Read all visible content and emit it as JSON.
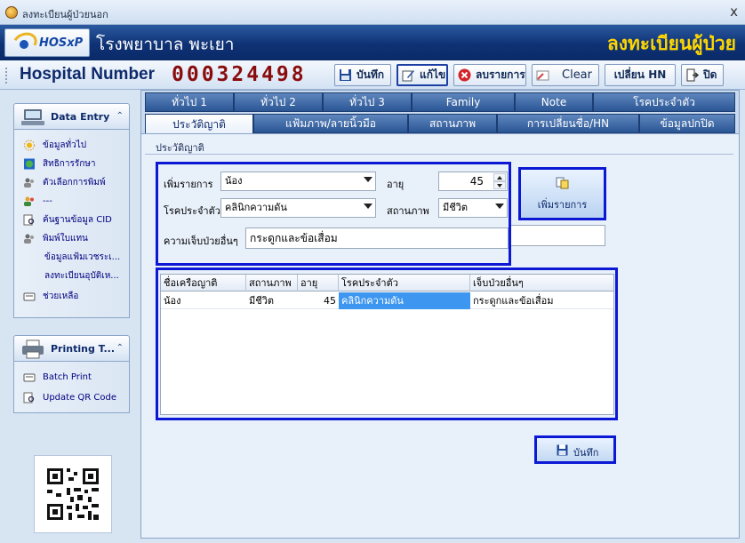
{
  "window": {
    "title": "ลงทะเบียนผู้ป่วยนอก",
    "close_label": "x"
  },
  "banner": {
    "logo_text": "HOSxP",
    "hospital_name": "โรงพยาบาล พะเยา",
    "module_name": "ลงทะเบียนผู้ป่วย"
  },
  "hn": {
    "label": "Hospital Number",
    "value": "000324498"
  },
  "toolbar": {
    "save": "บันทึก",
    "edit": "แก้ไข",
    "delete": "ลบรายการ",
    "clear": "Clear",
    "change_hn": "เปลี่ยน HN",
    "close": "ปิด"
  },
  "sidebar": {
    "data_entry": {
      "title": "Data Entry",
      "items": [
        {
          "label": "ข้อมูลทั่วไป",
          "icon": "sun-icon"
        },
        {
          "label": "สิทธิการรักษา",
          "icon": "globe-icon"
        },
        {
          "label": "ตัวเลือกการพิมพ์",
          "icon": "people-icon"
        },
        {
          "label": "---",
          "icon": "users-icon"
        },
        {
          "label": "ค้นฐานข้อมูล CID",
          "icon": "search-doc-icon"
        },
        {
          "label": "พิมพ์ใบแทน",
          "icon": "people-icon"
        },
        {
          "label": "ข้อมูลแฟ้มเวชระเ...",
          "icon": ""
        },
        {
          "label": "ลงทะเบียนอุบัติเห...",
          "icon": ""
        },
        {
          "label": "ช่วยเหลือ",
          "icon": "card-icon"
        }
      ]
    },
    "printing": {
      "title": "Printing T...",
      "items": [
        {
          "label": "Batch Print",
          "icon": "card-icon"
        },
        {
          "label": "Update QR Code",
          "icon": "search-doc-icon"
        }
      ]
    }
  },
  "tabs": {
    "row1": [
      "ทั่วไป 1",
      "ทั่วไป 2",
      "ทั่วไป 3",
      "Family",
      "Note",
      "โรคประจำตัว"
    ],
    "row2": [
      "ประวัติญาติ",
      "แฟ้มภาพ/ลายนิ้วมือ",
      "สถานภาพ",
      "การเปลี่ยนชื่อ/HN",
      "ข้อมูลปกปิด"
    ],
    "active": "ประวัติญาติ"
  },
  "relatives": {
    "section_title": "ประวัติญาติ",
    "form": {
      "add_item_label": "เพิ่มรายการ",
      "add_item_value": "น้อง",
      "age_label": "อายุ",
      "age_value": "45",
      "disease_label": "โรคประจำตัว",
      "disease_value": "คลินิกความดัน",
      "status_label": "สถานภาพ",
      "status_value": "มีชีวิต",
      "other_illness_label": "ความเจ็บป่วยอื่นๆ",
      "other_illness_value": "กระดูกและข้อเสื่อม"
    },
    "add_button": "เพิ่มรายการ",
    "table": {
      "columns": [
        "ชื่อเครือญาติ",
        "สถานภาพ",
        "อายุ",
        "โรคประจำตัว",
        "เจ็บป่วยอื่นๆ"
      ],
      "rows": [
        [
          "น้อง",
          "มีชีวิต",
          "45",
          "คลินิกความดัน",
          "กระดูกและข้อเสื่อม"
        ]
      ]
    },
    "save_button": "บันทึก"
  }
}
